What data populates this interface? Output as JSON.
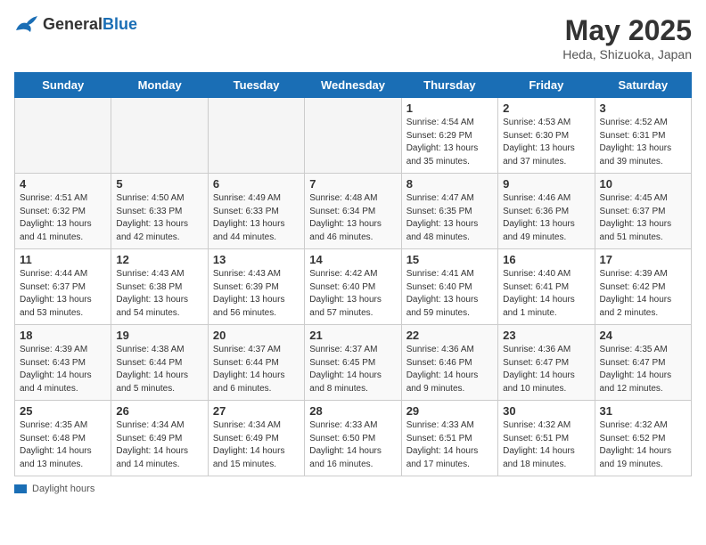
{
  "header": {
    "logo_general": "General",
    "logo_blue": "Blue",
    "main_title": "May 2025",
    "subtitle": "Heda, Shizuoka, Japan"
  },
  "days": [
    "Sunday",
    "Monday",
    "Tuesday",
    "Wednesday",
    "Thursday",
    "Friday",
    "Saturday"
  ],
  "footer_label": "Daylight hours",
  "weeks": [
    [
      {
        "date": "",
        "info": ""
      },
      {
        "date": "",
        "info": ""
      },
      {
        "date": "",
        "info": ""
      },
      {
        "date": "",
        "info": ""
      },
      {
        "date": "1",
        "info": "Sunrise: 4:54 AM\nSunset: 6:29 PM\nDaylight: 13 hours\nand 35 minutes."
      },
      {
        "date": "2",
        "info": "Sunrise: 4:53 AM\nSunset: 6:30 PM\nDaylight: 13 hours\nand 37 minutes."
      },
      {
        "date": "3",
        "info": "Sunrise: 4:52 AM\nSunset: 6:31 PM\nDaylight: 13 hours\nand 39 minutes."
      }
    ],
    [
      {
        "date": "4",
        "info": "Sunrise: 4:51 AM\nSunset: 6:32 PM\nDaylight: 13 hours\nand 41 minutes."
      },
      {
        "date": "5",
        "info": "Sunrise: 4:50 AM\nSunset: 6:33 PM\nDaylight: 13 hours\nand 42 minutes."
      },
      {
        "date": "6",
        "info": "Sunrise: 4:49 AM\nSunset: 6:33 PM\nDaylight: 13 hours\nand 44 minutes."
      },
      {
        "date": "7",
        "info": "Sunrise: 4:48 AM\nSunset: 6:34 PM\nDaylight: 13 hours\nand 46 minutes."
      },
      {
        "date": "8",
        "info": "Sunrise: 4:47 AM\nSunset: 6:35 PM\nDaylight: 13 hours\nand 48 minutes."
      },
      {
        "date": "9",
        "info": "Sunrise: 4:46 AM\nSunset: 6:36 PM\nDaylight: 13 hours\nand 49 minutes."
      },
      {
        "date": "10",
        "info": "Sunrise: 4:45 AM\nSunset: 6:37 PM\nDaylight: 13 hours\nand 51 minutes."
      }
    ],
    [
      {
        "date": "11",
        "info": "Sunrise: 4:44 AM\nSunset: 6:37 PM\nDaylight: 13 hours\nand 53 minutes."
      },
      {
        "date": "12",
        "info": "Sunrise: 4:43 AM\nSunset: 6:38 PM\nDaylight: 13 hours\nand 54 minutes."
      },
      {
        "date": "13",
        "info": "Sunrise: 4:43 AM\nSunset: 6:39 PM\nDaylight: 13 hours\nand 56 minutes."
      },
      {
        "date": "14",
        "info": "Sunrise: 4:42 AM\nSunset: 6:40 PM\nDaylight: 13 hours\nand 57 minutes."
      },
      {
        "date": "15",
        "info": "Sunrise: 4:41 AM\nSunset: 6:40 PM\nDaylight: 13 hours\nand 59 minutes."
      },
      {
        "date": "16",
        "info": "Sunrise: 4:40 AM\nSunset: 6:41 PM\nDaylight: 14 hours\nand 1 minute."
      },
      {
        "date": "17",
        "info": "Sunrise: 4:39 AM\nSunset: 6:42 PM\nDaylight: 14 hours\nand 2 minutes."
      }
    ],
    [
      {
        "date": "18",
        "info": "Sunrise: 4:39 AM\nSunset: 6:43 PM\nDaylight: 14 hours\nand 4 minutes."
      },
      {
        "date": "19",
        "info": "Sunrise: 4:38 AM\nSunset: 6:44 PM\nDaylight: 14 hours\nand 5 minutes."
      },
      {
        "date": "20",
        "info": "Sunrise: 4:37 AM\nSunset: 6:44 PM\nDaylight: 14 hours\nand 6 minutes."
      },
      {
        "date": "21",
        "info": "Sunrise: 4:37 AM\nSunset: 6:45 PM\nDaylight: 14 hours\nand 8 minutes."
      },
      {
        "date": "22",
        "info": "Sunrise: 4:36 AM\nSunset: 6:46 PM\nDaylight: 14 hours\nand 9 minutes."
      },
      {
        "date": "23",
        "info": "Sunrise: 4:36 AM\nSunset: 6:47 PM\nDaylight: 14 hours\nand 10 minutes."
      },
      {
        "date": "24",
        "info": "Sunrise: 4:35 AM\nSunset: 6:47 PM\nDaylight: 14 hours\nand 12 minutes."
      }
    ],
    [
      {
        "date": "25",
        "info": "Sunrise: 4:35 AM\nSunset: 6:48 PM\nDaylight: 14 hours\nand 13 minutes."
      },
      {
        "date": "26",
        "info": "Sunrise: 4:34 AM\nSunset: 6:49 PM\nDaylight: 14 hours\nand 14 minutes."
      },
      {
        "date": "27",
        "info": "Sunrise: 4:34 AM\nSunset: 6:49 PM\nDaylight: 14 hours\nand 15 minutes."
      },
      {
        "date": "28",
        "info": "Sunrise: 4:33 AM\nSunset: 6:50 PM\nDaylight: 14 hours\nand 16 minutes."
      },
      {
        "date": "29",
        "info": "Sunrise: 4:33 AM\nSunset: 6:51 PM\nDaylight: 14 hours\nand 17 minutes."
      },
      {
        "date": "30",
        "info": "Sunrise: 4:32 AM\nSunset: 6:51 PM\nDaylight: 14 hours\nand 18 minutes."
      },
      {
        "date": "31",
        "info": "Sunrise: 4:32 AM\nSunset: 6:52 PM\nDaylight: 14 hours\nand 19 minutes."
      }
    ]
  ]
}
